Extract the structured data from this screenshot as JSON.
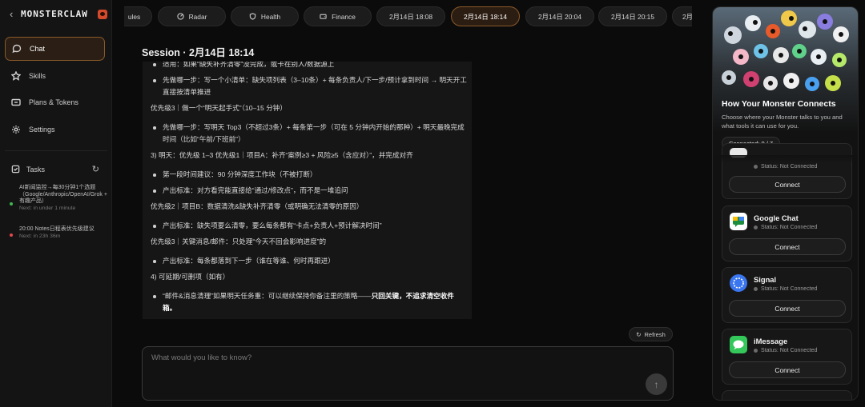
{
  "app": {
    "brand": "MONSTERCLAW"
  },
  "sidebar": {
    "items": [
      {
        "label": "Chat",
        "icon": "chat-bubble-icon",
        "active": true
      },
      {
        "label": "Skills",
        "icon": "star-icon"
      },
      {
        "label": "Plans & Tokens",
        "icon": "card-icon"
      },
      {
        "label": "Settings",
        "icon": "gear-icon"
      }
    ],
    "tasks_label": "Tasks",
    "tasks": [
      {
        "text": "AI新闻监控→每30分钟1个选题（Google/Anthropic/OpenAI/Grok + 有趣产品）",
        "next": "Next: in under 1 minute",
        "color": "#3fb950"
      },
      {
        "text": "20:00 Notes日程表优先级建议",
        "next": "Next: in 23h 36m",
        "color": "#e5484d"
      }
    ]
  },
  "tabs": [
    {
      "label": "ules",
      "icon": ""
    },
    {
      "label": "Radar",
      "icon": "radar-icon"
    },
    {
      "label": "Health",
      "icon": "shield-icon"
    },
    {
      "label": "Finance",
      "icon": "wallet-icon"
    },
    {
      "label": "2月14日 18:08"
    },
    {
      "label": "2月14日 18:14",
      "active": true
    },
    {
      "label": "2月14日 20:04"
    },
    {
      "label": "2月14日 20:15"
    },
    {
      "label": "2月"
    }
  ],
  "session": {
    "title": "Session · 2月14日 18:14",
    "lines": [
      {
        "type": "bullet",
        "text": "适用：如果“缺失补齐清零”没完成，或卡在别人/数据源上"
      },
      {
        "type": "bullet",
        "text": "先做哪一步：写一个小清单：缺失项列表（3–10条）+ 每条负责人/下一步/预计拿到时间 → 明天开工直接按清单推进"
      },
      {
        "type": "para",
        "text": "优先级3｜做一个“明天起手式”（10–15 分钟）"
      },
      {
        "type": "bullet",
        "text": "先做哪一步：写明天 Top3（不超过3条）+ 每条第一步（可在 5 分钟内开始的那种）+ 明天最晚完成时间（比如“午前/下班前”）"
      },
      {
        "type": "para",
        "text": "3) 明天：优先级 1–3 优先级1｜项目A：补齐“案例≥3 + 风险≥5（含应对）”，并完成对齐"
      },
      {
        "type": "bullet",
        "text": "第一段时间建议：90 分钟深度工作块（不被打断）"
      },
      {
        "type": "bullet",
        "text": "产出标准：对方看完能直接给“通过/修改点”，而不是一堆追问"
      },
      {
        "type": "para",
        "text": "优先级2｜项目B：数据清洗&缺失补齐清零（或明确无法清零的原因）"
      },
      {
        "type": "bullet",
        "text": "产出标准：缺失项要么清零，要么每条都有“卡点+负责人+预计解决时间”"
      },
      {
        "type": "para",
        "text": "优先级3｜关键消息/邮件：只处理“今天不回会影响进度”的"
      },
      {
        "type": "bullet",
        "text": "产出标准：每条都落到下一步（谁在等谁、何时再跟进）"
      },
      {
        "type": "para",
        "text": "4) 可延期/可删项（如有）"
      },
      {
        "type": "bullet",
        "text": "“邮件&消息清理”如果明天任务重：可以继续保持你备注里的策略——",
        "strong": "只回关键，不追求清空收件箱。"
      }
    ]
  },
  "refresh_label": "Refresh",
  "chat": {
    "placeholder": "What would you like to know?"
  },
  "panel": {
    "title": "How Your Monster Connects",
    "description": "Choose where your Monster talks to you and what tools it can use for you.",
    "connected": "Connected: 0 / 7",
    "cards": [
      {
        "name": "",
        "status": "Status: Not Connected",
        "button": "Connect",
        "color": "#e8e8e8"
      },
      {
        "name": "Google Chat",
        "status": "Status: Not Connected",
        "button": "Connect",
        "color": "#1e8e3e"
      },
      {
        "name": "Signal",
        "status": "Status: Not Connected",
        "button": "Connect",
        "color": "#3a76f0"
      },
      {
        "name": "iMessage",
        "status": "Status: Not Connected",
        "button": "Connect",
        "color": "#34c759"
      }
    ]
  }
}
